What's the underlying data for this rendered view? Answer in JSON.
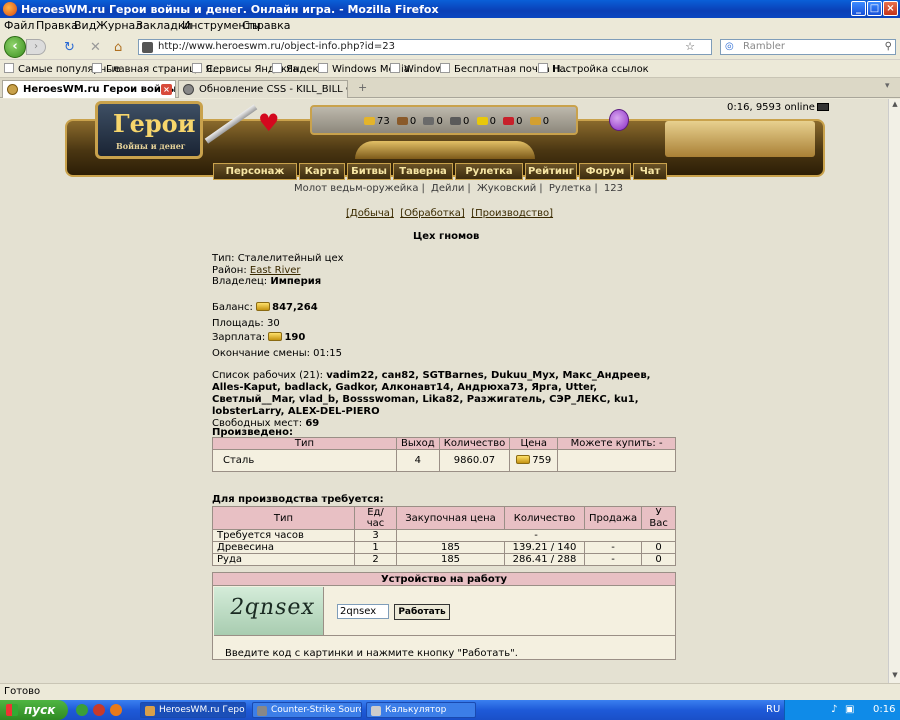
{
  "window": {
    "title": "HeroesWM.ru Герои войны и денег. Онлайн игра. - Mozilla Firefox",
    "min": "_",
    "max": "□",
    "close": "×"
  },
  "menu": [
    "Файл",
    "Правка",
    "Вид",
    "Журнал",
    "Закладки",
    "Инструменты",
    "Справка"
  ],
  "nav": {
    "url": "http://www.heroeswm.ru/object-info.php?id=23",
    "search_placeholder": "Rambler",
    "back": "‹",
    "forward": "›",
    "reload": "↻",
    "stop": "✕",
    "home": "⌂",
    "star": "☆",
    "search_icon": "⚲"
  },
  "bookmarks": [
    "Самые популярные",
    "Главная страница Я...",
    "Сервисы Яндекса",
    "Яндекс",
    "Windows Media",
    "Windows",
    "Бесплатная почта H...",
    "Настройка ссылок"
  ],
  "tabs": [
    {
      "label": "HeroesWM.ru Герои войны и ден..."
    },
    {
      "label": "Обновление CSS - KILL_BILL Форум"
    }
  ],
  "tab_new": "+",
  "online": "0:16, 9593 online",
  "banner": {
    "logo_main": "Герои",
    "logo_sub": "Войны и денег",
    "resources": [
      "73",
      "0",
      "0",
      "0",
      "0",
      "0",
      "0"
    ]
  },
  "gamenav": [
    "Персонаж",
    "Карта",
    "Битвы",
    "Таверна",
    "Рулетка",
    "Рейтинг",
    "Форум",
    "Чат"
  ],
  "sublinks": [
    "Молот ведьм-оружейка",
    "Дейли",
    "Жуковский",
    "Рулетка",
    "123"
  ],
  "page_tabs": [
    "[Добыча]",
    "[Обработка]",
    "[Производство]"
  ],
  "page_title": "Цех гномов",
  "info": {
    "type_label": "Тип:",
    "type_value": "Сталелитейный цех",
    "district_label": "Район:",
    "district_value": "East River",
    "owner_label": "Владелец:",
    "owner_value": "Империя",
    "balance_label": "Баланс:",
    "balance_value": "847,264",
    "area_label": "Площадь:",
    "area_value": "30",
    "salary_label": "Зарплата:",
    "salary_value": "190",
    "shift_label": "Окончание смены:",
    "shift_value": "01:15"
  },
  "workers": {
    "label": "Список рабочих (21):",
    "names": "vadim22, сан82, SGTBarnes, Dukuu_Мух, Макс_Андреев, Alles-Kaput, badlack, Gadkor, Алконавт14, Андрюха73, Ярга, Utter, Светлый__Mar, vlad_b, Bossswoman, Lika82, Разжигатель, СЭР_ЛЕКС, ku1, lobsterLarry, ALEX-DEL-PIERO",
    "free_label": "Свободных мест:",
    "free_value": "69"
  },
  "produced": {
    "heading": "Произведено:",
    "headers": [
      "Тип",
      "Выход",
      "Количество",
      "Цена",
      "Можете купить: -"
    ],
    "rows": [
      {
        "type": "Сталь",
        "output": "4",
        "quantity": "9860.07",
        "price": "759",
        "buy": ""
      }
    ]
  },
  "required": {
    "heading": "Для производства требуется:",
    "headers": [
      "Тип",
      "Ед/час",
      "Закупочная цена",
      "Количество",
      "Продажа",
      "У Вас"
    ],
    "rows": [
      {
        "type": "Требуется часов",
        "rate": "3",
        "price": "",
        "quantity": "-",
        "sale": "",
        "have": ""
      },
      {
        "type": "Древесина",
        "rate": "1",
        "price": "185",
        "quantity": "139.21 / 140",
        "sale": "-",
        "have": "0"
      },
      {
        "type": "Руда",
        "rate": "2",
        "price": "185",
        "quantity": "286.41 / 288",
        "sale": "-",
        "have": "0"
      }
    ]
  },
  "hire": {
    "heading": "Устройство на работу",
    "captcha_text": "2qnsex",
    "code_value": "2qnsex",
    "button": "Работать",
    "hint": "Введите код с картинки и нажмите кнопку \"Работать\"."
  },
  "status": "Готово",
  "taskbar": {
    "start": "пуск",
    "items": [
      "HeroesWM.ru Герои ...",
      "Counter-Strike Source",
      "Калькулятор"
    ],
    "lang": "RU",
    "clock": "0:16"
  }
}
